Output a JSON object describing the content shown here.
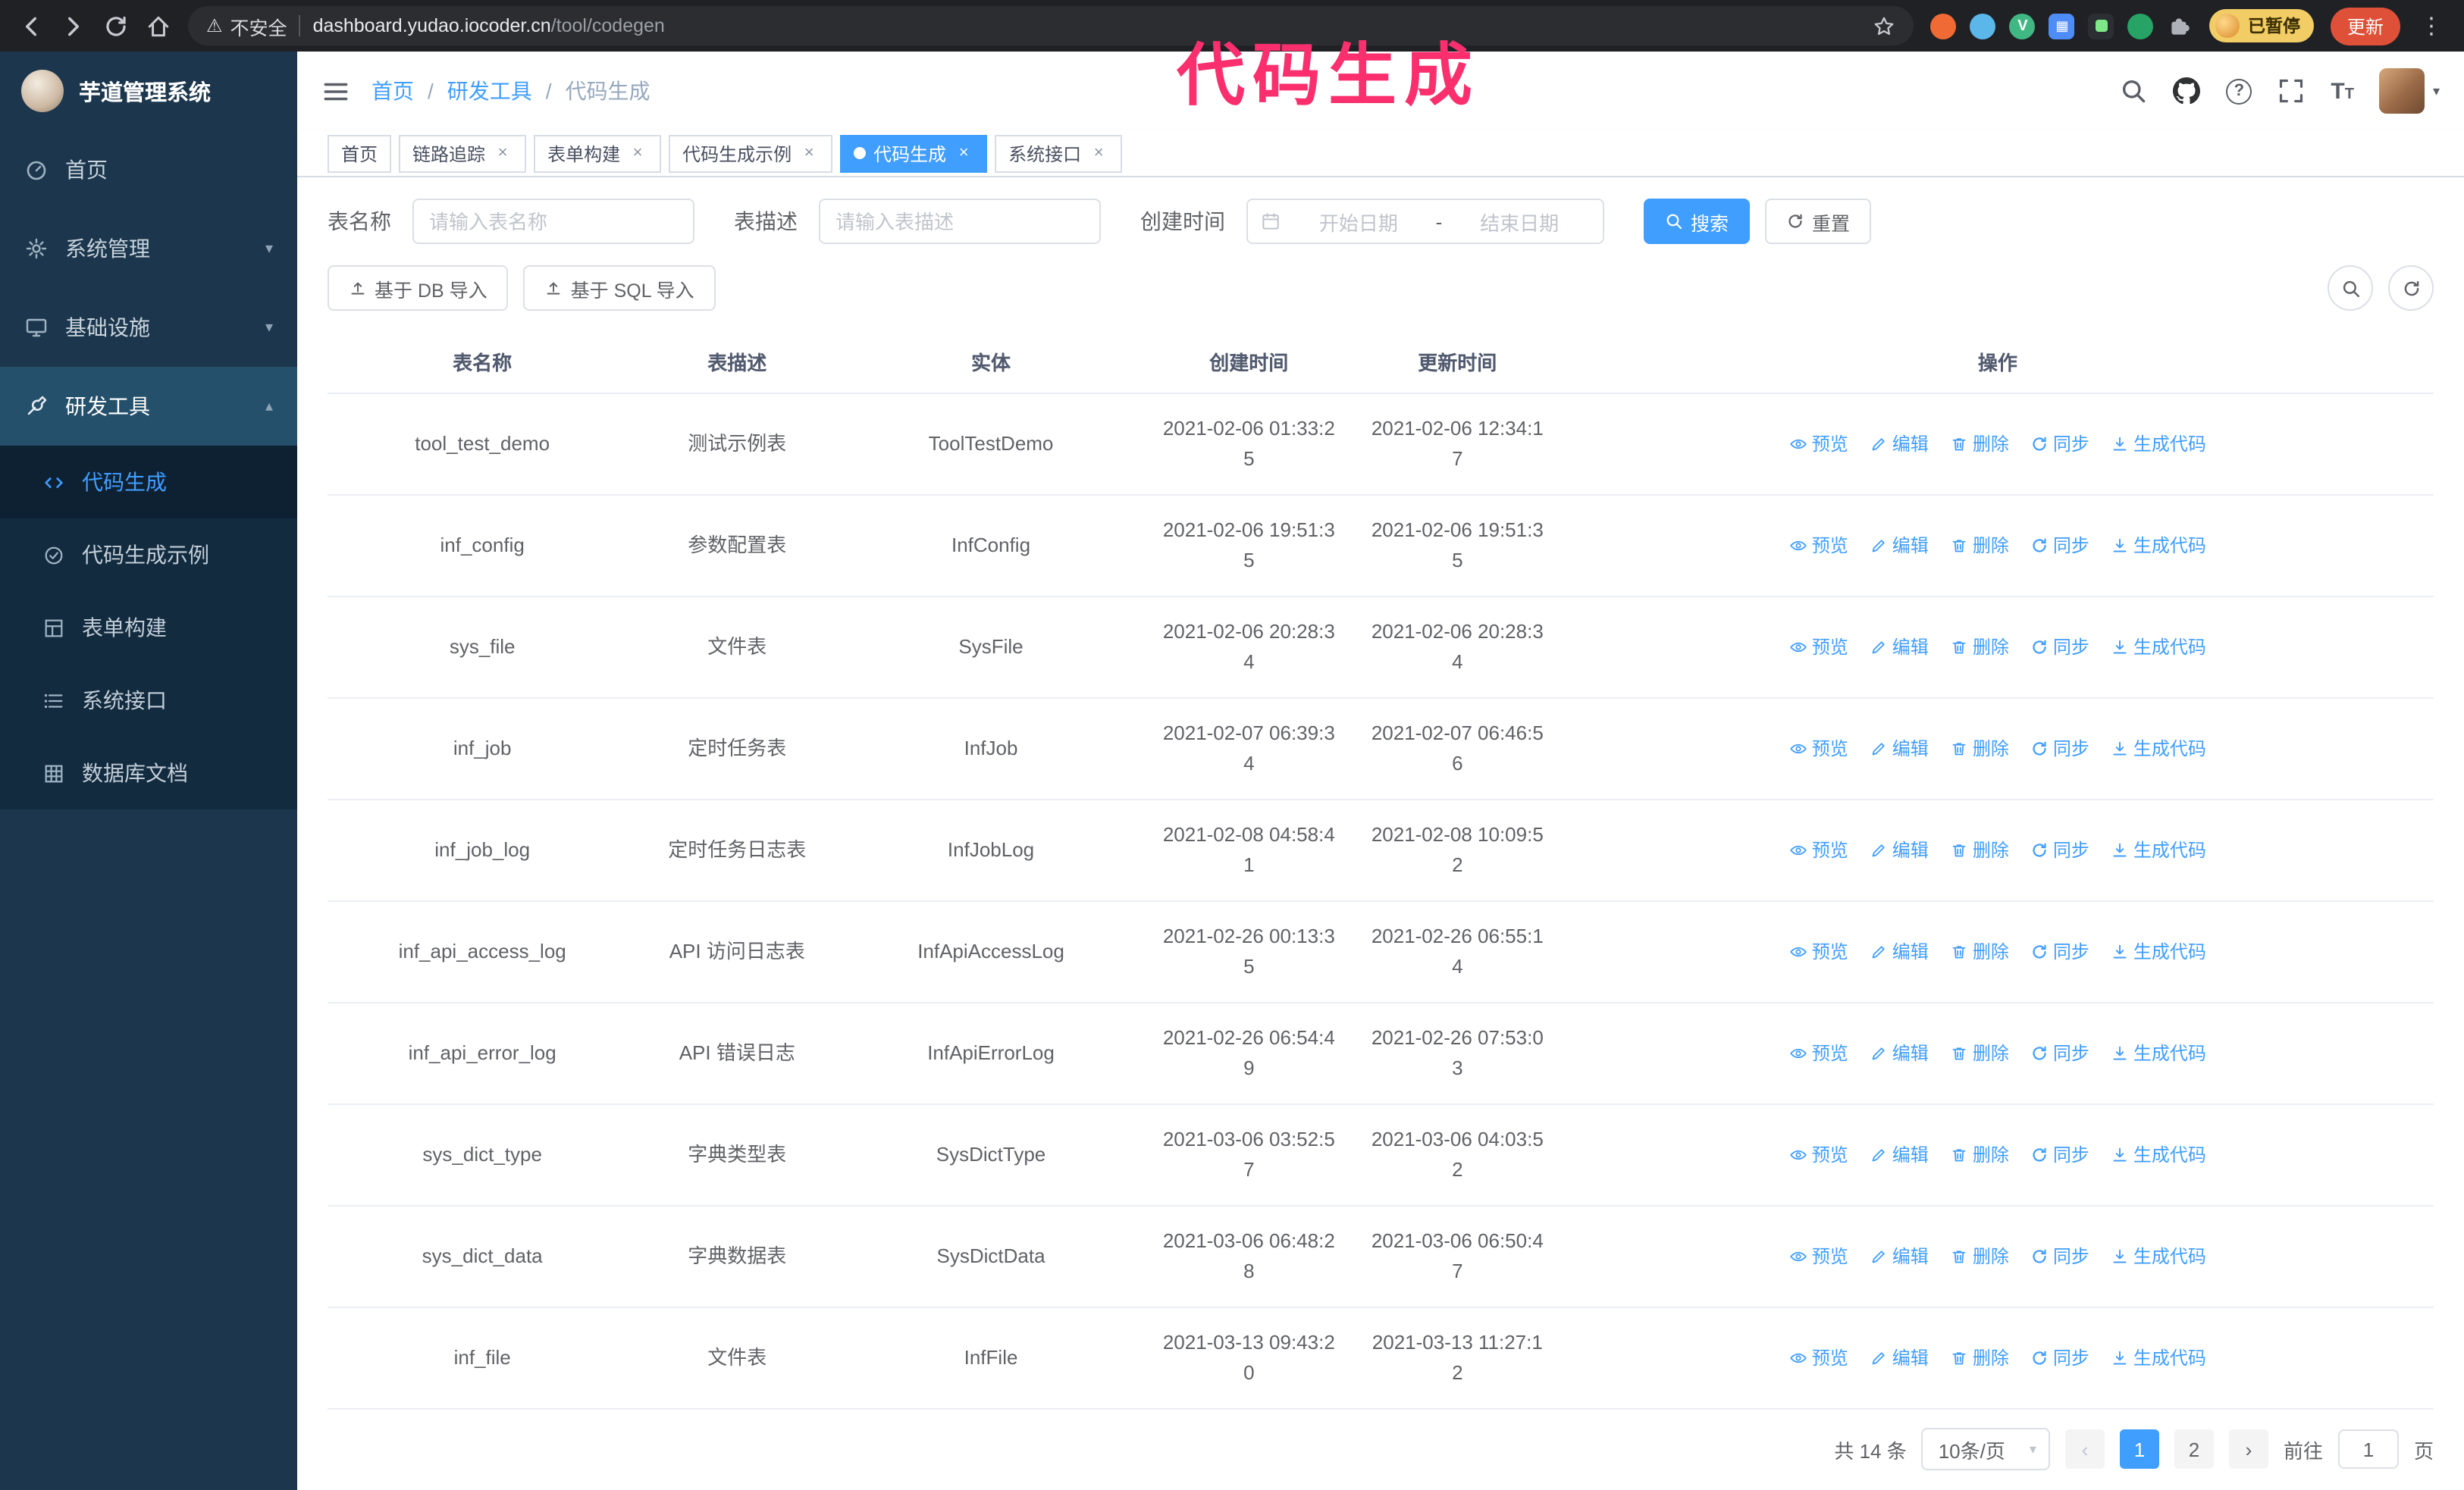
{
  "accent": "#409eff",
  "annotation": {
    "label": "代码生成"
  },
  "browser": {
    "security_label": "不安全",
    "url_host": "dashboard.yudao.iocoder.cn",
    "url_path": "/tool/codegen",
    "profile_badge": "已暂停",
    "update_label": "更新"
  },
  "sidebar": {
    "logo_title": "芋道管理系统",
    "menu": [
      {
        "label": "首页"
      },
      {
        "label": "系统管理"
      },
      {
        "label": "基础设施"
      },
      {
        "label": "研发工具"
      }
    ],
    "submenu": [
      {
        "label": "代码生成"
      },
      {
        "label": "代码生成示例"
      },
      {
        "label": "表单构建"
      },
      {
        "label": "系统接口"
      },
      {
        "label": "数据库文档"
      }
    ]
  },
  "navbar": {
    "breadcrumb": [
      "首页",
      "研发工具",
      "代码生成"
    ]
  },
  "tabs": [
    {
      "label": "首页"
    },
    {
      "label": "链路追踪"
    },
    {
      "label": "表单构建"
    },
    {
      "label": "代码生成示例"
    },
    {
      "label": "代码生成"
    },
    {
      "label": "系统接口"
    }
  ],
  "filters": {
    "name_label": "表名称",
    "name_placeholder": "请输入表名称",
    "desc_label": "表描述",
    "desc_placeholder": "请输入表描述",
    "time_label": "创建时间",
    "start_placeholder": "开始日期",
    "range_separator": "-",
    "end_placeholder": "结束日期",
    "search_label": "搜索",
    "reset_label": "重置"
  },
  "toolbar": {
    "import_db_label": "基于 DB 导入",
    "import_sql_label": "基于 SQL 导入"
  },
  "table": {
    "columns": [
      "表名称",
      "表描述",
      "实体",
      "创建时间",
      "更新时间",
      "操作"
    ],
    "actions": [
      "预览",
      "编辑",
      "删除",
      "同步",
      "生成代码"
    ],
    "rows": [
      {
        "name": "tool_test_demo",
        "desc": "测试示例表",
        "entity": "ToolTestDemo",
        "created": "2021-02-06 01:33:25",
        "updated": "2021-02-06 12:34:17"
      },
      {
        "name": "inf_config",
        "desc": "参数配置表",
        "entity": "InfConfig",
        "created": "2021-02-06 19:51:35",
        "updated": "2021-02-06 19:51:35"
      },
      {
        "name": "sys_file",
        "desc": "文件表",
        "entity": "SysFile",
        "created": "2021-02-06 20:28:34",
        "updated": "2021-02-06 20:28:34"
      },
      {
        "name": "inf_job",
        "desc": "定时任务表",
        "entity": "InfJob",
        "created": "2021-02-07 06:39:34",
        "updated": "2021-02-07 06:46:56"
      },
      {
        "name": "inf_job_log",
        "desc": "定时任务日志表",
        "entity": "InfJobLog",
        "created": "2021-02-08 04:58:41",
        "updated": "2021-02-08 10:09:52"
      },
      {
        "name": "inf_api_access_log",
        "desc": "API 访问日志表",
        "entity": "InfApiAccessLog",
        "created": "2021-02-26 00:13:35",
        "updated": "2021-02-26 06:55:14"
      },
      {
        "name": "inf_api_error_log",
        "desc": "API 错误日志",
        "entity": "InfApiErrorLog",
        "created": "2021-02-26 06:54:49",
        "updated": "2021-02-26 07:53:03"
      },
      {
        "name": "sys_dict_type",
        "desc": "字典类型表",
        "entity": "SysDictType",
        "created": "2021-03-06 03:52:57",
        "updated": "2021-03-06 04:03:52"
      },
      {
        "name": "sys_dict_data",
        "desc": "字典数据表",
        "entity": "SysDictData",
        "created": "2021-03-06 06:48:28",
        "updated": "2021-03-06 06:50:47"
      },
      {
        "name": "inf_file",
        "desc": "文件表",
        "entity": "InfFile",
        "created": "2021-03-13 09:43:20",
        "updated": "2021-03-13 11:27:12"
      }
    ]
  },
  "pagination": {
    "total": "共 14 条",
    "page_size": "10条/页",
    "page_1": "1",
    "page_2": "2",
    "goto_label": "前往",
    "goto_value": "1",
    "unit_label": "页"
  },
  "icons": [
    "back-icon",
    "forward-icon",
    "reload-icon",
    "home-icon",
    "warning-icon",
    "bookmark-star-icon",
    "extensions-puzzle-icon",
    "search-icon",
    "github-icon",
    "question-icon",
    "fullscreen-icon",
    "font-size-icon",
    "calendar-icon",
    "refresh-icon",
    "upload-icon",
    "eye-icon",
    "edit-icon",
    "delete-icon",
    "sync-icon",
    "download-icon"
  ]
}
